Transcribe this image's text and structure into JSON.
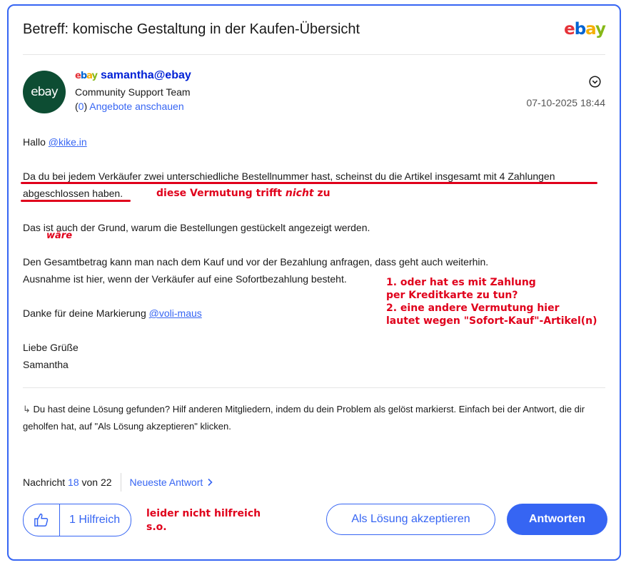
{
  "subject": "Betreff: komische Gestaltung in der Kaufen-Übersicht",
  "logo": {
    "e": "e",
    "b": "b",
    "a": "a",
    "y": "y"
  },
  "author": {
    "avatar_text": "ebay",
    "name": "samantha@ebay",
    "rank": "Community Support Team",
    "offers_open": "(",
    "offers_count": "0",
    "offers_close": ")",
    "offers_label": "Angebote anschauen"
  },
  "date": "07-10-2025 18:44",
  "message": {
    "greeting": "Hallo",
    "greeting_mention": "@kike.in",
    "p1_line1": "Da du bei jedem Verkäufer zwei unterschiedliche Bestellnummer hast, scheinst du die Artikel insgesamt mit 4 Zahlungen",
    "p1_line2": "abgeschlossen haben.",
    "p2": "Das ist auch der Grund, warum die Bestellungen gestückelt angezeigt werden.",
    "p3_line1": "Den Gesamtbetrag kann man nach dem Kauf und vor der Bezahlung anfragen, dass geht auch weiterhin.",
    "p3_line2": "Ausnahme ist hier, wenn der Verkäufer auf eine Sofortbezahlung besteht.",
    "thanks": "Danke für deine Markierung",
    "thanks_mention": "@voli-maus",
    "closing1": "Liebe Grüße",
    "closing2": "Samantha"
  },
  "annotations": {
    "a1_pre": "diese Vermutung trifft ",
    "a1_italic": "nicht",
    "a1_post": " zu",
    "a2": "wäre",
    "a3_l1": "1. oder hat es mit Zahlung",
    "a3_l2": "per Kreditkarte zu tun?",
    "a3_l3": "2. eine andere Vermutung hier",
    "a3_l4": "lautet wegen \"Sofort-Kauf\"-Artikel(n)",
    "a4_l1": "leider nicht hilfreich",
    "a4_l2": "s.o."
  },
  "hint": {
    "arrow": "↳",
    "text": "Du hast deine Lösung gefunden? Hilf anderen Mitgliedern, indem du dein Problem als gelöst markierst. Einfach bei der Antwort, die dir geholfen hat, auf \"Als Lösung akzeptieren\" klicken."
  },
  "pager": {
    "prefix": "Nachricht",
    "current": "18",
    "mid": "von",
    "total": "22",
    "newest": "Neueste Antwort"
  },
  "actions": {
    "helpful": "1 Hilfreich",
    "accept": "Als Lösung akzeptieren",
    "reply": "Antworten"
  },
  "colors": {
    "accent": "#3665f3",
    "annotation": "#e0001b",
    "avatar_bg": "#0d4d33"
  }
}
